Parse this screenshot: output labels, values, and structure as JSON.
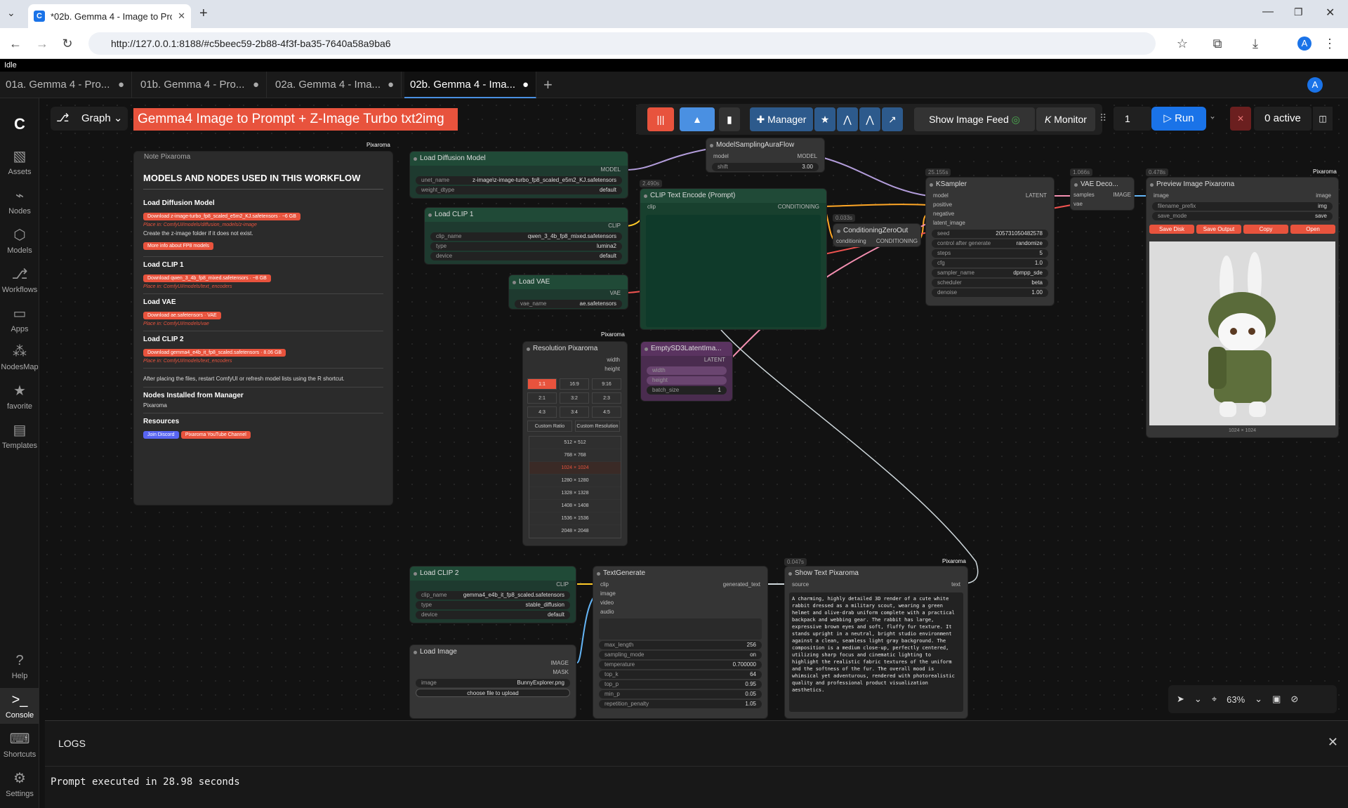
{
  "browser": {
    "tab_title": "*02b. Gemma 4 - Image to Pro",
    "url": "http://127.0.0.1:8188/#c5beec59-2b88-4f3f-ba35-7640a58a9ba6",
    "avatar_letter": "A"
  },
  "status": "Idle",
  "workflow_tabs": [
    {
      "label": "01a. Gemma 4 - Pro...",
      "dot": "●"
    },
    {
      "label": "01b. Gemma 4 - Pro...",
      "dot": "●"
    },
    {
      "label": "02a. Gemma 4 - Ima...",
      "dot": "●"
    },
    {
      "label": "02b. Gemma 4 - Ima...",
      "dot": "●"
    }
  ],
  "sidebar": {
    "items": [
      "Assets",
      "Nodes",
      "Models",
      "Workflows",
      "Apps",
      "NodesMap",
      "favorite",
      "Templates"
    ],
    "bottom": [
      "Help",
      "Console",
      "Shortcuts",
      "Settings"
    ]
  },
  "toolbar": {
    "graph": "Graph",
    "title": "Gemma4 Image to Prompt + Z-Image Turbo txt2img",
    "manager": "Manager",
    "show_image_feed": "Show Image Feed",
    "monitor": "Monitor",
    "batch_count": "1",
    "run": "Run",
    "active": "0 active"
  },
  "note": {
    "header": "Note Pixaroma",
    "badge": "Pixaroma",
    "title": "MODELS AND NODES USED IN THIS WORKFLOW",
    "sections": [
      {
        "title": "Load Diffusion Model",
        "download": "Download z-image-turbo_fp8_scaled_e5m2_KJ.safetensors · ~6 GB",
        "place": "Place in: ComfyUI/models/diffusion_models/z-image",
        "extra": "Create the z-image folder if it does not exist.",
        "more": "More info about FP8 models"
      },
      {
        "title": "Load CLIP 1",
        "download": "Download qwen_3_4b_fp8_mixed.safetensors · ~8 GB",
        "place": "Place in: ComfyUI/models/text_encoders"
      },
      {
        "title": "Load VAE",
        "download": "Download ae.safetensors · VAE",
        "place": "Place in: ComfyUI/models/vae"
      },
      {
        "title": "Load CLIP 2",
        "download": "Download gemma4_e4b_it_fp8_scaled.safetensors · 8.06 GB",
        "place": "Place in: ComfyUI/models/text_encoders"
      }
    ],
    "warning": "After placing the files, restart ComfyUI or refresh model lists using the R shortcut.",
    "nodes_title": "Nodes Installed from Manager",
    "nodes_item": "Pixaroma",
    "resources_title": "Resources",
    "discord": "Join Discord",
    "youtube": "Pixaroma YouTube Channel"
  },
  "nodes": {
    "load_diffusion": {
      "title": "Load Diffusion Model",
      "out": "MODEL",
      "unet_label": "unet_name",
      "unet": "z-image\\z-image-turbo_fp8_scaled_e5m2_KJ.safetensors",
      "dtype_label": "weight_dtype",
      "dtype": "default"
    },
    "load_clip1": {
      "title": "Load CLIP 1",
      "out": "CLIP",
      "clip_label": "clip_name",
      "clip": "qwen_3_4b_fp8_mixed.safetensors",
      "type_label": "type",
      "type": "lumina2",
      "device_label": "device",
      "device": "default"
    },
    "load_vae": {
      "title": "Load VAE",
      "out": "VAE",
      "vae_label": "vae_name",
      "vae": "ae.safetensors"
    },
    "aura": {
      "title": "ModelSamplingAuraFlow",
      "in": "model",
      "out": "MODEL",
      "shift_label": "shift",
      "shift": "3.00"
    },
    "clip_encode": {
      "title": "CLIP Text Encode (Prompt)",
      "time": "2.490s",
      "in": "clip",
      "out": "CONDITIONING"
    },
    "zero_out": {
      "title": "ConditioningZeroOut",
      "time": "0.033s",
      "in": "conditioning",
      "out": "CONDITIONING"
    },
    "ksampler": {
      "title": "KSampler",
      "time": "25.155s",
      "ins": [
        "model",
        "positive",
        "negative",
        "latent_image"
      ],
      "out": "LATENT",
      "widgets": [
        [
          "seed",
          "205731050482578"
        ],
        [
          "control after generate",
          "randomize"
        ],
        [
          "steps",
          "5"
        ],
        [
          "cfg",
          "1.0"
        ],
        [
          "sampler_name",
          "dpmpp_sde"
        ],
        [
          "scheduler",
          "beta"
        ],
        [
          "denoise",
          "1.00"
        ]
      ]
    },
    "vae_decode": {
      "title": "VAE Deco...",
      "time": "1.066s",
      "in1": "samples",
      "in2": "vae",
      "out": "IMAGE"
    },
    "preview": {
      "title": "Preview Image Pixaroma",
      "time": "0.478s",
      "badge": "Pixaroma",
      "in": "image",
      "out": "image",
      "prefix_label": "filename_prefix",
      "prefix": "img",
      "mode_label": "save_mode",
      "mode": "save",
      "buttons": [
        "Save Disk",
        "Save Output",
        "Copy",
        "Open"
      ],
      "size": "1024 × 1024"
    },
    "resolution": {
      "title": "Resolution Pixaroma",
      "badge": "Pixaroma",
      "out1": "width",
      "out2": "height",
      "ratios": [
        "1:1",
        "16:9",
        "9:16",
        "2:1",
        "3:2",
        "2:3",
        "4:3",
        "3:4",
        "4:5"
      ],
      "custom1": "Custom Ratio",
      "custom2": "Custom Resolution",
      "sizes": [
        "512 × 512",
        "768 × 768",
        "1024 × 1024",
        "1280 × 1280",
        "1328 × 1328",
        "1408 × 1408",
        "1536 × 1536",
        "2048 × 2048"
      ]
    },
    "empty_latent": {
      "title": "EmptySD3LatentIma...",
      "out": "LATENT",
      "w": "width",
      "h": "height",
      "batch_label": "batch_size",
      "batch": "1"
    },
    "load_clip2": {
      "title": "Load CLIP 2",
      "out": "CLIP",
      "clip_label": "clip_name",
      "clip": "gemma4_e4b_it_fp8_scaled.safetensors",
      "type_label": "type",
      "type": "stable_diffusion",
      "device_label": "device",
      "device": "default"
    },
    "text_generate": {
      "title": "TextGenerate",
      "ins": [
        "clip",
        "image",
        "video",
        "audio"
      ],
      "out": "generated_text",
      "widgets": [
        [
          "max_length",
          "256"
        ],
        [
          "sampling_mode",
          "on"
        ],
        [
          "temperature",
          "0.700000"
        ],
        [
          "top_k",
          "64"
        ],
        [
          "top_p",
          "0.95"
        ],
        [
          "min_p",
          "0.05"
        ],
        [
          "repetition_penalty",
          "1.05"
        ]
      ]
    },
    "show_text": {
      "title": "Show Text Pixaroma",
      "time": "0.047s",
      "badge": "Pixaroma",
      "in": "source",
      "out": "text",
      "text": "A charming, highly detailed 3D render of a cute white rabbit dressed as a military scout, wearing a green helmet and olive-drab uniform complete with a practical backpack and webbing gear. The rabbit has large, expressive brown eyes and soft, fluffy fur texture. It stands upright in a neutral, bright studio environment against a clean, seamless light gray background. The composition is a medium close-up, perfectly centered, utilizing sharp focus and cinematic lighting to highlight the realistic fabric textures of the uniform and the softness of the fur. The overall mood is whimsical yet adventurous, rendered with photorealistic quality and professional product visualization aesthetics."
    },
    "load_image": {
      "title": "Load Image",
      "out1": "IMAGE",
      "out2": "MASK",
      "image_label": "image",
      "image": "BunnyExplorer.png",
      "upload": "choose file to upload"
    }
  },
  "zoom": "63%",
  "logs": {
    "title": "LOGS",
    "line": "Prompt executed in 28.98 seconds"
  }
}
